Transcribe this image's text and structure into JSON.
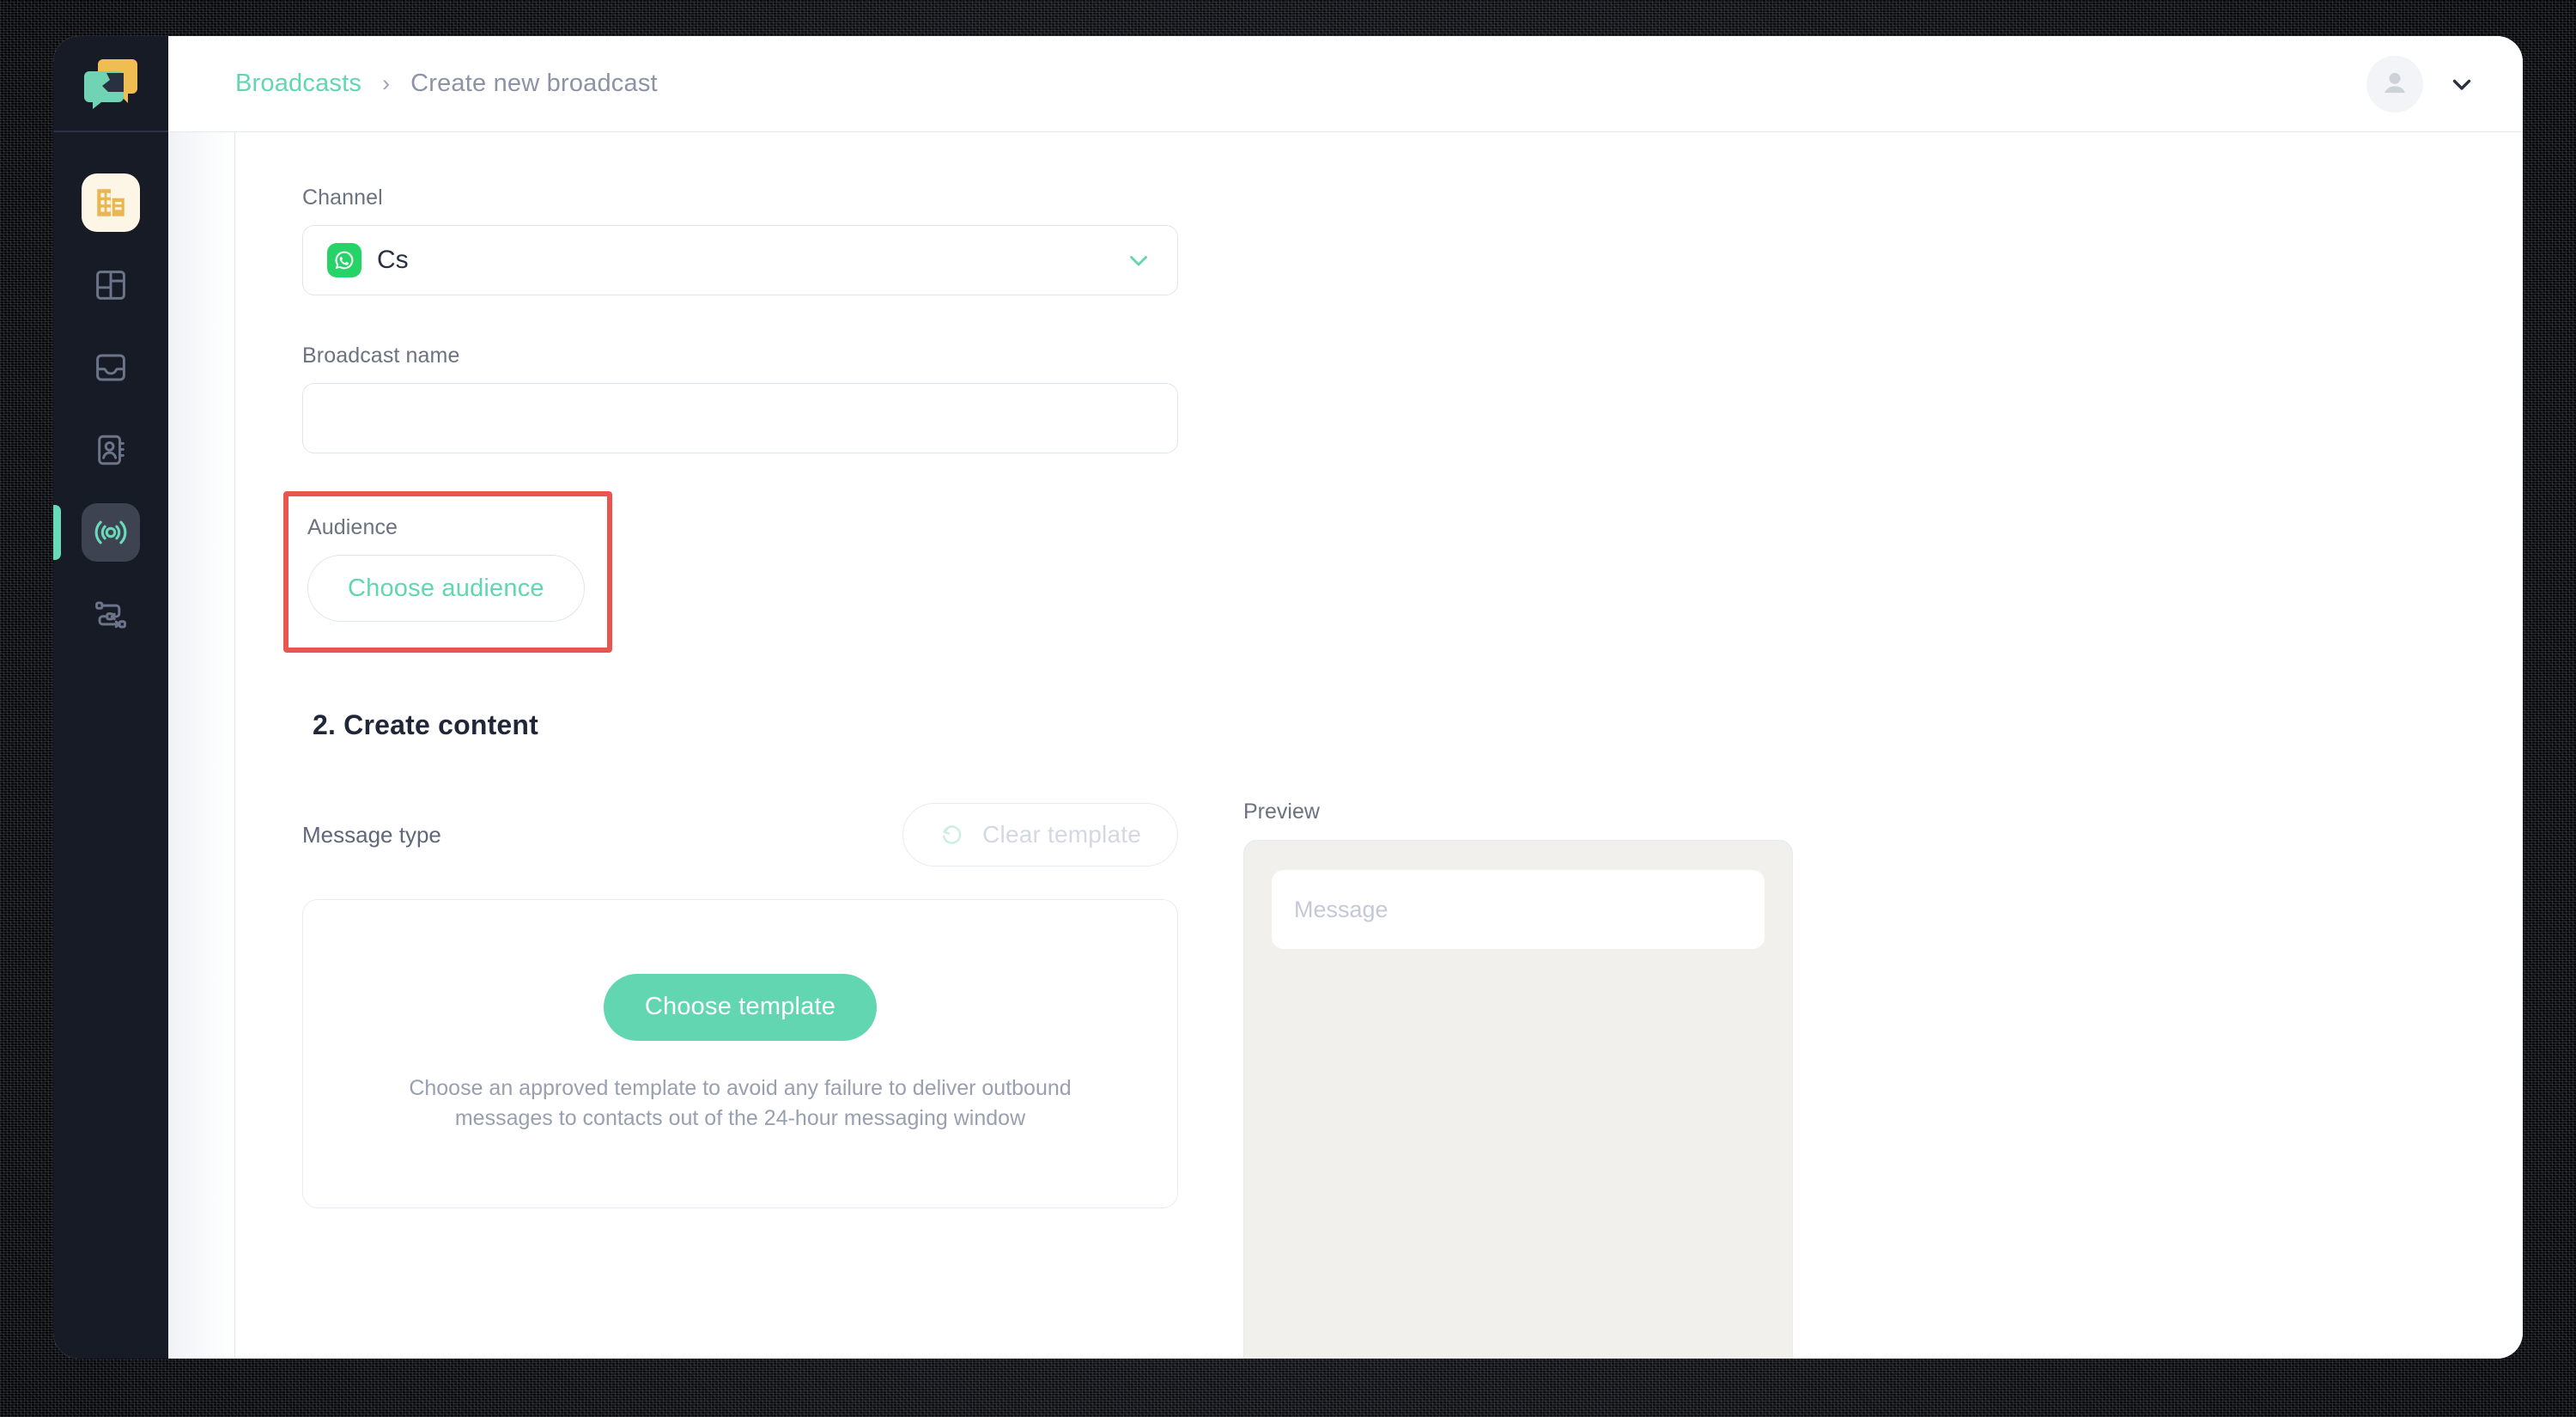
{
  "brand": {
    "accent_teal": "#62d6b1",
    "highlight_red": "#e8564f",
    "sidebar_bg": "#171b26",
    "logo_yellow": "#f0bd52",
    "logo_teal": "#6fd3b4",
    "whatsapp_green": "#25d366"
  },
  "sidebar": {
    "logo_name": "app-logo",
    "items": [
      {
        "icon": "company-building-icon",
        "name": "sidebar-item-company",
        "active": false,
        "highlighted": true
      },
      {
        "icon": "dashboard-layout-icon",
        "name": "sidebar-item-dashboard",
        "active": false,
        "highlighted": false
      },
      {
        "icon": "inbox-icon",
        "name": "sidebar-item-inbox",
        "active": false,
        "highlighted": false
      },
      {
        "icon": "contacts-book-icon",
        "name": "sidebar-item-contacts",
        "active": false,
        "highlighted": false
      },
      {
        "icon": "broadcast-icon",
        "name": "sidebar-item-broadcasts",
        "active": true,
        "highlighted": false
      },
      {
        "icon": "workflow-icon",
        "name": "sidebar-item-workflows",
        "active": false,
        "highlighted": false
      }
    ]
  },
  "topbar": {
    "breadcrumb_root": "Broadcasts",
    "breadcrumb_separator": "›",
    "breadcrumb_current": "Create new broadcast",
    "avatar_icon": "user-avatar-icon",
    "chevron_icon": "chevron-down-icon"
  },
  "form": {
    "channel": {
      "label": "Channel",
      "value": "Cs",
      "channel_icon": "whatsapp-icon",
      "chevron_icon": "chevron-down-icon"
    },
    "broadcast_name": {
      "label": "Broadcast name",
      "value": "",
      "placeholder": ""
    },
    "audience": {
      "label": "Audience",
      "button_label": "Choose audience",
      "annotated": true
    }
  },
  "create_content": {
    "heading": "2. Create content",
    "message_type_label": "Message type",
    "clear_template": {
      "label": "Clear template",
      "icon": "refresh-undo-icon",
      "disabled": true
    },
    "template_card": {
      "button_label": "Choose template",
      "help_text": "Choose an approved template to avoid any failure to deliver outbound messages to contacts out of the 24-hour messaging window"
    }
  },
  "preview": {
    "label": "Preview",
    "message_placeholder": "Message"
  }
}
